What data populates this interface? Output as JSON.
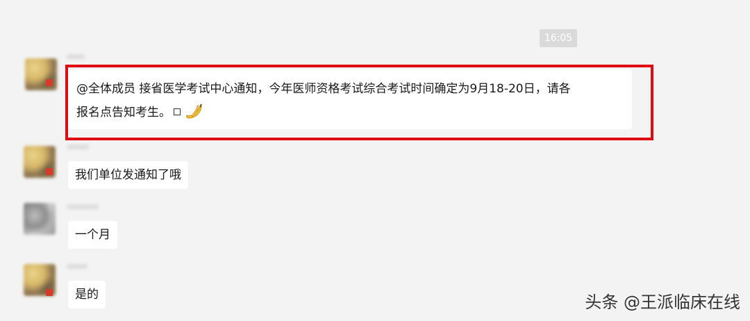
{
  "chat": {
    "timestamp": "16:05",
    "messages": [
      {
        "line1": "@全体成员 接省医学考试中心通知，今年医师资格考试综合考试时间确定为9月18-20日，请各",
        "line2": "报名点告知考生。",
        "emoji": "banana-icon"
      },
      {
        "text": "我们单位发通知了哦"
      },
      {
        "text": "一个月"
      },
      {
        "text": "是的"
      }
    ]
  },
  "annotation": {
    "highlight_color": "#e00a12"
  },
  "watermark": {
    "text": "头条 @王派临床在线"
  }
}
